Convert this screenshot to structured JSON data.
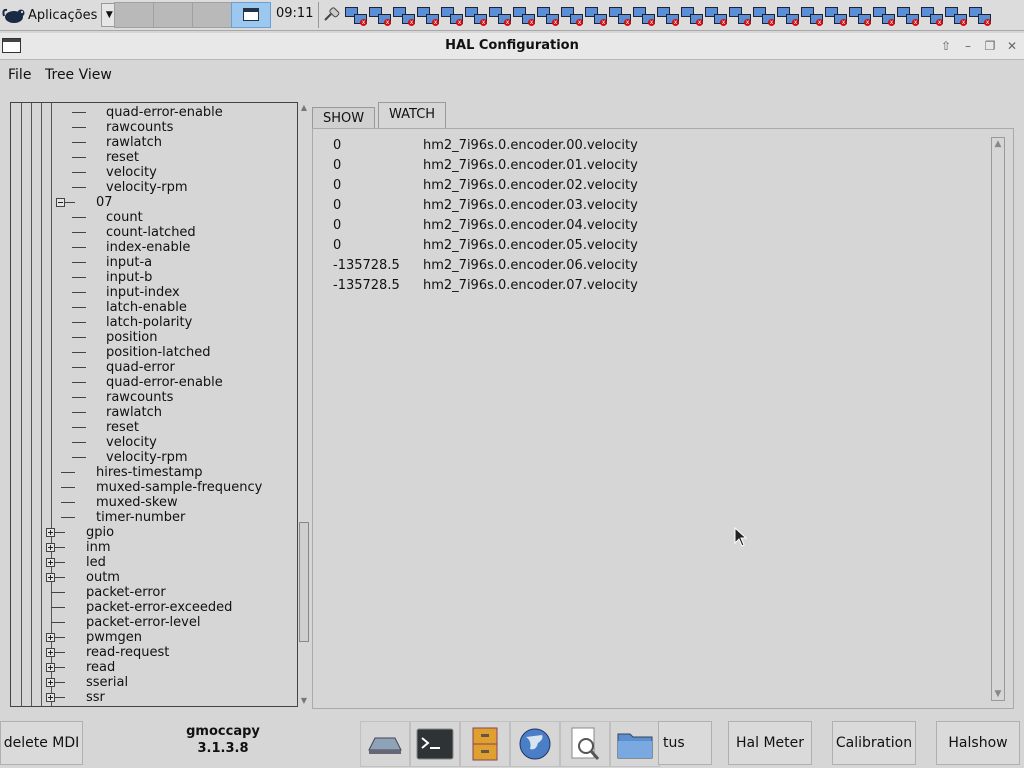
{
  "top_panel": {
    "app_menu_label": "Aplicações",
    "clock": "09:11",
    "network_icon_count": 27,
    "workspace_count": 4,
    "active_workspace": 4
  },
  "window": {
    "title": "HAL Configuration",
    "menu": {
      "file": "File",
      "tree_view": "Tree View"
    }
  },
  "tree": {
    "rows": [
      {
        "label": "quad-error-enable",
        "depth": 4,
        "expander": ""
      },
      {
        "label": "rawcounts",
        "depth": 4,
        "expander": ""
      },
      {
        "label": "rawlatch",
        "depth": 4,
        "expander": ""
      },
      {
        "label": "reset",
        "depth": 4,
        "expander": ""
      },
      {
        "label": "velocity",
        "depth": 4,
        "expander": ""
      },
      {
        "label": "velocity-rpm",
        "depth": 4,
        "expander": ""
      },
      {
        "label": "07",
        "depth": 3,
        "expander": "minus"
      },
      {
        "label": "count",
        "depth": 4,
        "expander": ""
      },
      {
        "label": "count-latched",
        "depth": 4,
        "expander": ""
      },
      {
        "label": "index-enable",
        "depth": 4,
        "expander": ""
      },
      {
        "label": "input-a",
        "depth": 4,
        "expander": ""
      },
      {
        "label": "input-b",
        "depth": 4,
        "expander": ""
      },
      {
        "label": "input-index",
        "depth": 4,
        "expander": ""
      },
      {
        "label": "latch-enable",
        "depth": 4,
        "expander": ""
      },
      {
        "label": "latch-polarity",
        "depth": 4,
        "expander": ""
      },
      {
        "label": "position",
        "depth": 4,
        "expander": ""
      },
      {
        "label": "position-latched",
        "depth": 4,
        "expander": ""
      },
      {
        "label": "quad-error",
        "depth": 4,
        "expander": ""
      },
      {
        "label": "quad-error-enable",
        "depth": 4,
        "expander": ""
      },
      {
        "label": "rawcounts",
        "depth": 4,
        "expander": ""
      },
      {
        "label": "rawlatch",
        "depth": 4,
        "expander": ""
      },
      {
        "label": "reset",
        "depth": 4,
        "expander": ""
      },
      {
        "label": "velocity",
        "depth": 4,
        "expander": ""
      },
      {
        "label": "velocity-rpm",
        "depth": 4,
        "expander": ""
      },
      {
        "label": "hires-timestamp",
        "depth": 3,
        "expander": ""
      },
      {
        "label": "muxed-sample-frequency",
        "depth": 3,
        "expander": ""
      },
      {
        "label": "muxed-skew",
        "depth": 3,
        "expander": ""
      },
      {
        "label": "timer-number",
        "depth": 3,
        "expander": ""
      },
      {
        "label": "gpio",
        "depth": 2,
        "expander": "plus"
      },
      {
        "label": "inm",
        "depth": 2,
        "expander": "plus"
      },
      {
        "label": "led",
        "depth": 2,
        "expander": "plus"
      },
      {
        "label": "outm",
        "depth": 2,
        "expander": "plus"
      },
      {
        "label": "packet-error",
        "depth": 2,
        "expander": ""
      },
      {
        "label": "packet-error-exceeded",
        "depth": 2,
        "expander": ""
      },
      {
        "label": "packet-error-level",
        "depth": 2,
        "expander": ""
      },
      {
        "label": "pwmgen",
        "depth": 2,
        "expander": "plus"
      },
      {
        "label": "read-request",
        "depth": 2,
        "expander": "plus"
      },
      {
        "label": "read",
        "depth": 2,
        "expander": "plus"
      },
      {
        "label": "sserial",
        "depth": 2,
        "expander": "plus"
      },
      {
        "label": "ssr",
        "depth": 2,
        "expander": "plus"
      }
    ]
  },
  "tabs": {
    "show": "SHOW",
    "watch": "WATCH",
    "active": "watch"
  },
  "watch": {
    "rows": [
      {
        "value": "0",
        "name": "hm2_7i96s.0.encoder.00.velocity"
      },
      {
        "value": "0",
        "name": "hm2_7i96s.0.encoder.01.velocity"
      },
      {
        "value": "0",
        "name": "hm2_7i96s.0.encoder.02.velocity"
      },
      {
        "value": "0",
        "name": "hm2_7i96s.0.encoder.03.velocity"
      },
      {
        "value": "0",
        "name": "hm2_7i96s.0.encoder.04.velocity"
      },
      {
        "value": "0",
        "name": "hm2_7i96s.0.encoder.05.velocity"
      },
      {
        "value": "-135728.5",
        "name": "hm2_7i96s.0.encoder.06.velocity"
      },
      {
        "value": "-135728.5",
        "name": "hm2_7i96s.0.encoder.07.velocity"
      }
    ]
  },
  "bottom_bar": {
    "delete_mdi": "delete MDI",
    "app_name": "gmoccapy",
    "app_version": "3.1.3.8",
    "status_partial": "tus",
    "hal_meter": "Hal Meter",
    "calibration": "Calibration",
    "halshow": "Halshow",
    "dock_icons": [
      "machine-icon",
      "terminal-icon",
      "file-cabinet-icon",
      "globe-icon",
      "search-document-icon",
      "folder-icon"
    ]
  }
}
